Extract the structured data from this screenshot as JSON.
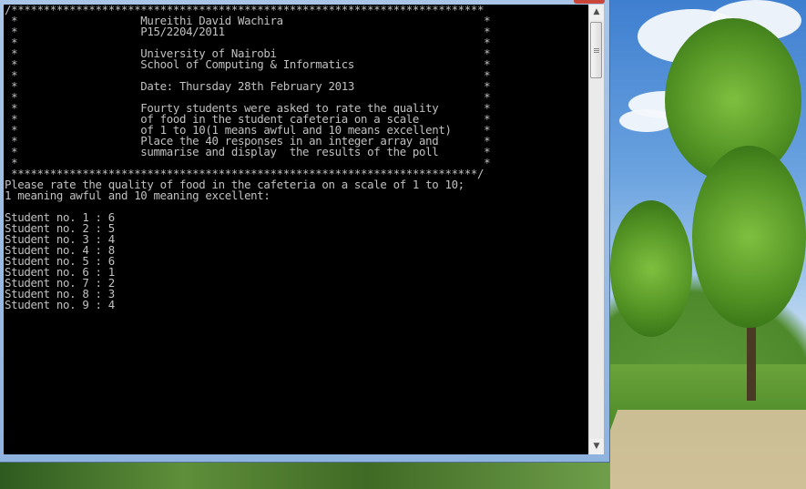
{
  "window": {
    "type": "console"
  },
  "console": {
    "lines": [
      "/*************************************************************************",
      " *                   Mureithi David Wachira                               *",
      " *                   P15/2204/2011                                        *",
      " *                                                                        *",
      " *                   University of Nairobi                                *",
      " *                   School of Computing & Informatics                    *",
      " *                                                                        *",
      " *                   Date: Thursday 28th February 2013                    *",
      " *                                                                        *",
      " *                   Fourty students were asked to rate the quality       *",
      " *                   of food in the student cafeteria on a scale          *",
      " *                   of 1 to 10(1 means awful and 10 means excellent)     *",
      " *                   Place the 40 responses in an integer array and       *",
      " *                   summarise and display  the results of the poll       *",
      " *                                                                        *",
      " ************************************************************************/",
      "Please rate the quality of food in the cafeteria on a scale of 1 to 10;",
      "1 meaning awful and 10 meaning excellent:",
      "",
      "Student no. 1 : 6",
      "Student no. 2 : 5",
      "Student no. 3 : 4",
      "Student no. 4 : 8",
      "Student no. 5 : 6",
      "Student no. 6 : 1",
      "Student no. 7 : 2",
      "Student no. 8 : 3",
      "Student no. 9 : 4"
    ]
  },
  "scrollbar": {
    "up_icon": "▲",
    "down_icon": "▼"
  },
  "colors": {
    "console_bg": "#000000",
    "console_fg": "#c0c0c0",
    "frame": "#9fbde3"
  }
}
